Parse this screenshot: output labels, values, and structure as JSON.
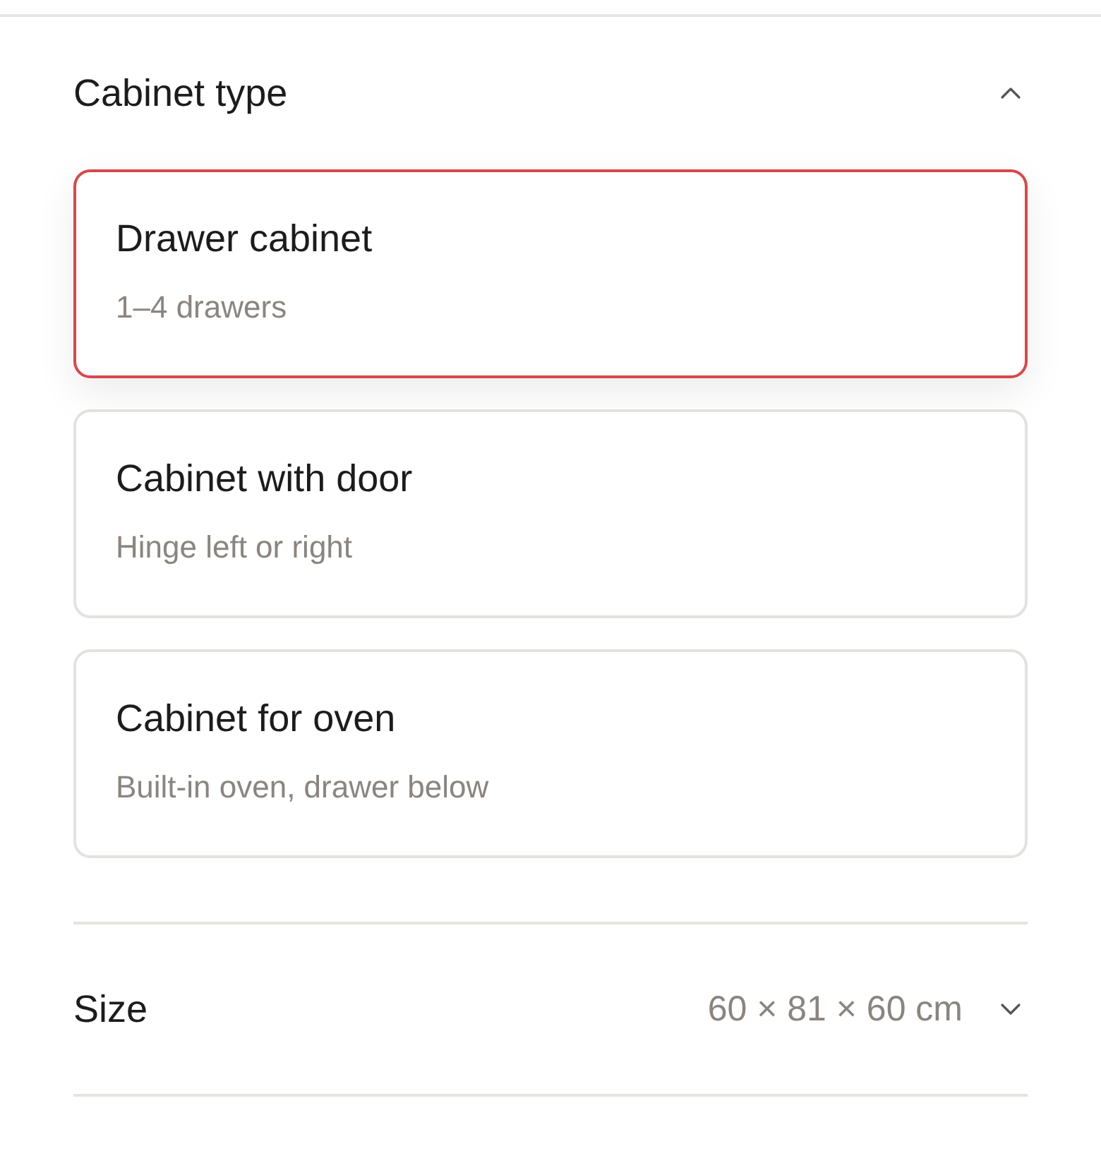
{
  "cabinet_type": {
    "title": "Cabinet type",
    "expanded": true,
    "options": [
      {
        "title": "Drawer cabinet",
        "subtitle": "1–4 drawers",
        "selected": true
      },
      {
        "title": "Cabinet with door",
        "subtitle": "Hinge left or right",
        "selected": false
      },
      {
        "title": "Cabinet for oven",
        "subtitle": "Built-in oven, drawer below",
        "selected": false
      }
    ]
  },
  "size": {
    "title": "Size",
    "value": "60 × 81 × 60 cm",
    "expanded": false
  }
}
